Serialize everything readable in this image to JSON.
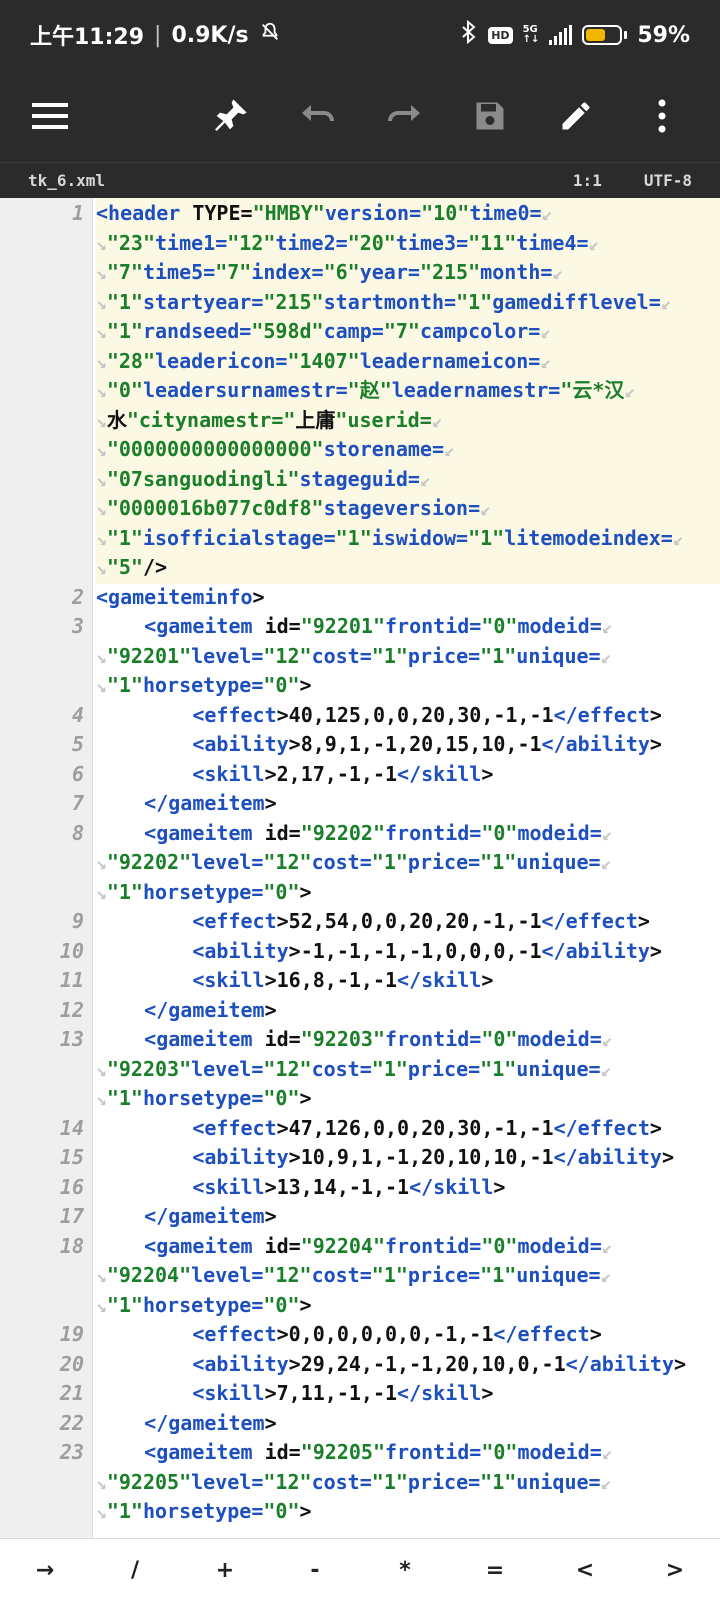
{
  "status": {
    "time": "上午11:29",
    "speed": "0.9K/s",
    "hd": "HD",
    "net": "5G",
    "battery_percent": "59%",
    "battery_level": 0.59,
    "battery_color": "#f2b500"
  },
  "toolbar": {
    "menu_icon": "hamburger-menu-icon",
    "pin_icon": "pin-icon",
    "undo_icon": "undo-icon",
    "redo_icon": "redo-icon",
    "save_icon": "save-icon",
    "edit_icon": "pencil-icon",
    "more_icon": "more-vert-icon"
  },
  "file": {
    "name": "tk_6.xml",
    "cursor": "1:1",
    "encoding": "UTF-8"
  },
  "editor": {
    "lines": [
      {
        "num": "1",
        "text": "<header TYPE=\"HMBY\"version=\"10\"time0=",
        "wrap": true
      },
      {
        "num": "",
        "text": "\"23\"time1=\"12\"time2=\"20\"time3=\"11\"time4=",
        "wrap": true
      },
      {
        "num": "",
        "text": "\"7\"time5=\"7\"index=\"6\"year=\"215\"month=",
        "wrap": true
      },
      {
        "num": "",
        "text": "\"1\"startyear=\"215\"startmonth=\"1\"gamedifflevel=",
        "wrap": true
      },
      {
        "num": "",
        "text": "\"1\"randseed=\"598d\"camp=\"7\"campcolor=",
        "wrap": true
      },
      {
        "num": "",
        "text": "\"28\"leadericon=\"1407\"leadernameicon=",
        "wrap": true
      },
      {
        "num": "",
        "text": "\"0\"leadersurnamestr=\"赵\"leadernamestr=\"云*汉",
        "wrap": true
      },
      {
        "num": "",
        "text": "水\"citynamestr=\"上庸\"userid=",
        "wrap": true
      },
      {
        "num": "",
        "text": "\"0000000000000000\"storename=",
        "wrap": true
      },
      {
        "num": "",
        "text": "\"07sanguodingli\"stageguid=",
        "wrap": true
      },
      {
        "num": "",
        "text": "\"0000016b077c0df8\"stageversion=",
        "wrap": true
      },
      {
        "num": "",
        "text": "\"1\"isofficialstage=\"1\"iswidow=\"1\"litemodeindex=",
        "wrap": true
      },
      {
        "num": "",
        "text": "\"5\"/>",
        "wrap": false
      },
      {
        "num": "2",
        "text": "<gameiteminfo>",
        "wrap": false
      },
      {
        "num": "3",
        "text": "    <gameitem id=\"92201\"frontid=\"0\"modeid=",
        "wrap": true
      },
      {
        "num": "",
        "text": "\"92201\"level=\"12\"cost=\"1\"price=\"1\"unique=",
        "wrap": true
      },
      {
        "num": "",
        "text": "\"1\"horsetype=\"0\">",
        "wrap": false
      },
      {
        "num": "4",
        "text": "        <effect>40,125,0,0,20,30,-1,-1</effect>",
        "wrap": false
      },
      {
        "num": "5",
        "text": "        <ability>8,9,1,-1,20,15,10,-1</ability>",
        "wrap": false
      },
      {
        "num": "6",
        "text": "        <skill>2,17,-1,-1</skill>",
        "wrap": false
      },
      {
        "num": "7",
        "text": "    </gameitem>",
        "wrap": false
      },
      {
        "num": "8",
        "text": "    <gameitem id=\"92202\"frontid=\"0\"modeid=",
        "wrap": true
      },
      {
        "num": "",
        "text": "\"92202\"level=\"12\"cost=\"1\"price=\"1\"unique=",
        "wrap": true
      },
      {
        "num": "",
        "text": "\"1\"horsetype=\"0\">",
        "wrap": false
      },
      {
        "num": "9",
        "text": "        <effect>52,54,0,0,20,20,-1,-1</effect>",
        "wrap": false
      },
      {
        "num": "10",
        "text": "        <ability>-1,-1,-1,-1,0,0,0,-1</ability>",
        "wrap": false
      },
      {
        "num": "11",
        "text": "        <skill>16,8,-1,-1</skill>",
        "wrap": false
      },
      {
        "num": "12",
        "text": "    </gameitem>",
        "wrap": false
      },
      {
        "num": "13",
        "text": "    <gameitem id=\"92203\"frontid=\"0\"modeid=",
        "wrap": true
      },
      {
        "num": "",
        "text": "\"92203\"level=\"12\"cost=\"1\"price=\"1\"unique=",
        "wrap": true
      },
      {
        "num": "",
        "text": "\"1\"horsetype=\"0\">",
        "wrap": false
      },
      {
        "num": "14",
        "text": "        <effect>47,126,0,0,20,30,-1,-1</effect>",
        "wrap": false
      },
      {
        "num": "15",
        "text": "        <ability>10,9,1,-1,20,10,10,-1</ability>",
        "wrap": false
      },
      {
        "num": "16",
        "text": "        <skill>13,14,-1,-1</skill>",
        "wrap": false
      },
      {
        "num": "17",
        "text": "    </gameitem>",
        "wrap": false
      },
      {
        "num": "18",
        "text": "    <gameitem id=\"92204\"frontid=\"0\"modeid=",
        "wrap": true
      },
      {
        "num": "",
        "text": "\"92204\"level=\"12\"cost=\"1\"price=\"1\"unique=",
        "wrap": true
      },
      {
        "num": "",
        "text": "\"1\"horsetype=\"0\">",
        "wrap": false
      },
      {
        "num": "19",
        "text": "        <effect>0,0,0,0,0,0,-1,-1</effect>",
        "wrap": false
      },
      {
        "num": "20",
        "text": "        <ability>29,24,-1,-1,20,10,0,-1</ability>",
        "wrap": false
      },
      {
        "num": "21",
        "text": "        <skill>7,11,-1,-1</skill>",
        "wrap": false
      },
      {
        "num": "22",
        "text": "    </gameitem>",
        "wrap": false
      },
      {
        "num": "23",
        "text": "    <gameitem id=\"92205\"frontid=\"0\"modeid=",
        "wrap": true
      },
      {
        "num": "",
        "text": "\"92205\"level=\"12\"cost=\"1\"price=\"1\"unique=",
        "wrap": true
      },
      {
        "num": "",
        "text": "\"1\"horsetype=\"0\">",
        "wrap": false
      }
    ]
  },
  "bottom_keys": [
    "→",
    "/",
    "+",
    "-",
    "*",
    "=",
    "<",
    ">"
  ]
}
